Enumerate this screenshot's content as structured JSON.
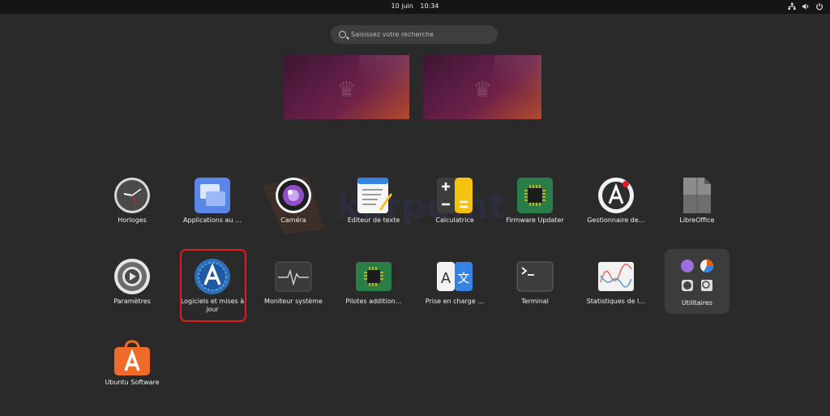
{
  "topbar": {
    "date": "10 juin",
    "time": "10:34",
    "icons": [
      "network-icon",
      "volume-icon",
      "power-icon"
    ]
  },
  "search": {
    "placeholder": "Saisissez votre recherche"
  },
  "workspaces": [
    {
      "name": "workspace-1"
    },
    {
      "name": "workspace-2"
    }
  ],
  "apps": [
    {
      "label": "Horloges",
      "icon": "clock-icon"
    },
    {
      "label": "Applications au …",
      "icon": "window-icon"
    },
    {
      "label": "Caméra",
      "icon": "camera-icon"
    },
    {
      "label": "Éditeur de texte",
      "icon": "text-editor-icon"
    },
    {
      "label": "Calculatrice",
      "icon": "calculator-icon"
    },
    {
      "label": "Firmware Updater",
      "icon": "chip-icon"
    },
    {
      "label": "Gestionnaire de…",
      "icon": "package-icon"
    },
    {
      "label": "LibreOffice",
      "icon": "libreoffice-icon"
    },
    {
      "label": "Paramètres",
      "icon": "gear-icon"
    },
    {
      "label": "Logiciels et mises à jour",
      "icon": "software-updates-icon"
    },
    {
      "label": "Moniteur système",
      "icon": "monitor-icon"
    },
    {
      "label": "Pilotes addition…",
      "icon": "driver-chip-icon"
    },
    {
      "label": "Prise en charge …",
      "icon": "language-icon"
    },
    {
      "label": "Terminal",
      "icon": "terminal-icon"
    },
    {
      "label": "Statistiques de l…",
      "icon": "stats-icon"
    },
    {
      "label": "Utilitaires",
      "icon": "folder-icon"
    },
    {
      "label": "Ubuntu Software",
      "icon": "store-icon"
    }
  ],
  "colors": {
    "highlight": "#e01b24",
    "background": "#2a2a2a"
  }
}
